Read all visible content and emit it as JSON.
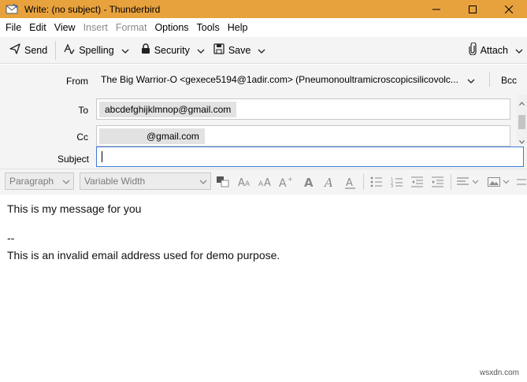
{
  "window": {
    "title": "Write: (no subject) - Thunderbird",
    "accent": "#e8a23d"
  },
  "menu": [
    "File",
    "Edit",
    "View",
    "Insert",
    "Format",
    "Options",
    "Tools",
    "Help"
  ],
  "menu_disabled": [
    "Insert",
    "Format"
  ],
  "toolbar": {
    "send": "Send",
    "spelling": "Spelling",
    "security": "Security",
    "save": "Save",
    "attach": "Attach"
  },
  "headers": {
    "from_label": "From",
    "from_value": "The Big Warrior-O <gexece5194@1adir.com> (Pneumonoultramicroscopicsilicovolc...",
    "bcc": "Bcc",
    "to_label": "To",
    "to_value": "abcdefghijklmnop@gmail.com",
    "cc_label": "Cc",
    "cc_value": "@gmail.com",
    "subject_label": "Subject",
    "subject_value": ""
  },
  "format_bar": {
    "paragraph": "Paragraph",
    "font": "Variable Width"
  },
  "body": {
    "line1": "This is my message for you",
    "sig_sep": "--",
    "sig": "This is an invalid email address used for demo purpose."
  },
  "watermark": "wsxdn.com"
}
